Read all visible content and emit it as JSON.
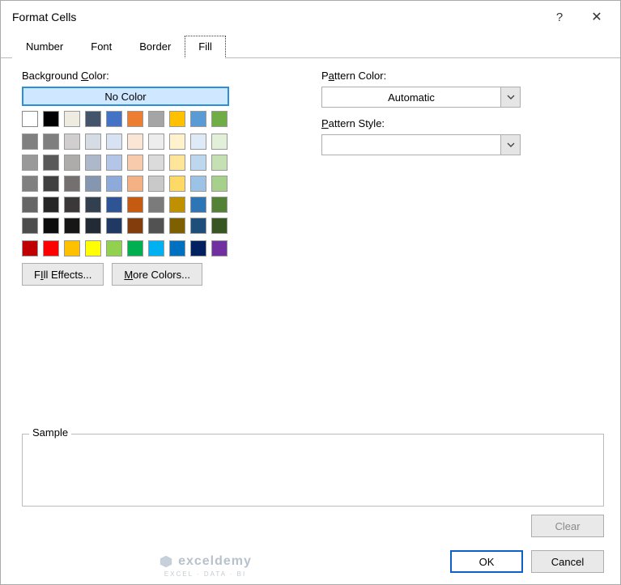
{
  "title": "Format Cells",
  "tabs": [
    "Number",
    "Font",
    "Border",
    "Fill"
  ],
  "active_tab": 3,
  "background_color_label": "Background Color:",
  "background_color_underline_char": "C",
  "no_color_label": "No Color",
  "pattern_color_label": "Pattern Color:",
  "pattern_color_underline_char": "A",
  "pattern_color_value": "Automatic",
  "pattern_style_label": "Pattern Style:",
  "pattern_style_underline_char": "P",
  "pattern_style_value": "",
  "fill_effects_label": "Fill Effects...",
  "fill_effects_underline_char": "I",
  "more_colors_label": "More Colors...",
  "more_colors_underline_char": "M",
  "sample_label": "Sample",
  "clear_label": "Clear",
  "ok_label": "OK",
  "cancel_label": "Cancel",
  "watermark": "exceldemy",
  "watermark_sub": "EXCEL · DATA · BI",
  "color_rows_theme_top": [
    [
      "#ffffff",
      "#000000",
      "#eeece1",
      "#44546a",
      "#4472c4",
      "#ed7d31",
      "#a5a5a5",
      "#ffc000",
      "#5b9bd5",
      "#70ad47"
    ]
  ],
  "color_rows_theme_grid": [
    [
      "#808080",
      "#7f7f7f",
      "#d0cece",
      "#d6dce4",
      "#d9e2f3",
      "#fbe5d5",
      "#ededed",
      "#fff2cc",
      "#deebf6",
      "#e2efd9"
    ],
    [
      "#999999",
      "#595959",
      "#aeabab",
      "#adb9ca",
      "#b4c6e7",
      "#f7cbac",
      "#dbdbdb",
      "#fee599",
      "#bdd7ee",
      "#c5e0b3"
    ],
    [
      "#808080",
      "#404040",
      "#757070",
      "#8496b0",
      "#8eaadb",
      "#f4b183",
      "#c9c9c9",
      "#ffd965",
      "#9cc3e5",
      "#a8d08d"
    ],
    [
      "#666666",
      "#262626",
      "#3a3838",
      "#323f4f",
      "#2f5496",
      "#c55a11",
      "#7b7b7b",
      "#bf9000",
      "#2e75b5",
      "#538135"
    ],
    [
      "#4d4d4d",
      "#0d0d0d",
      "#171616",
      "#222a35",
      "#1f3864",
      "#833c0b",
      "#525252",
      "#7f6000",
      "#1e4e79",
      "#375623"
    ]
  ],
  "color_rows_standard": [
    [
      "#c00000",
      "#ff0000",
      "#ffc000",
      "#ffff00",
      "#92d050",
      "#00b050",
      "#00b0f0",
      "#0070c0",
      "#002060",
      "#7030a0"
    ]
  ]
}
